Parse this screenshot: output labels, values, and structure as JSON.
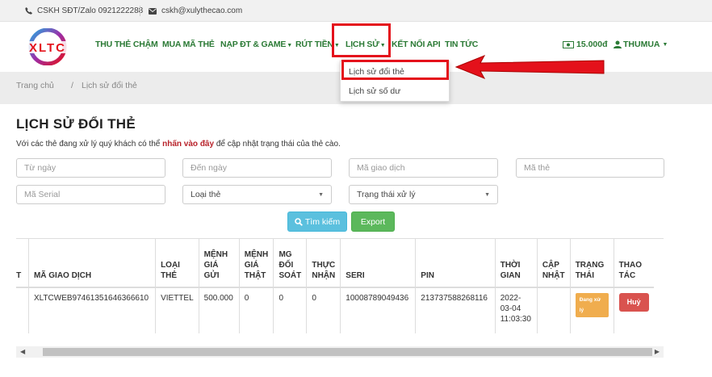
{
  "topbar": {
    "phone_text": "CSKH SĐT/Zalo 0921222288",
    "email_text": "cskh@xulythecao.com"
  },
  "logo": {
    "text": "XLTC"
  },
  "nav": {
    "items": [
      {
        "label": "THU THẺ CHẬM",
        "has_caret": false
      },
      {
        "label": "MUA MÃ THẺ",
        "has_caret": false
      },
      {
        "label": "NẠP ĐT & GAME",
        "has_caret": true
      },
      {
        "label": "RÚT TIỀN",
        "has_caret": true
      },
      {
        "label": "LỊCH SỬ",
        "has_caret": true
      },
      {
        "label": "KẾT NỐI API",
        "has_caret": false
      },
      {
        "label": "TIN TỨC",
        "has_caret": false
      }
    ],
    "balance": "15.000đ",
    "user": "THUMUA"
  },
  "dropdown": {
    "items": [
      "Lịch sử đổi thẻ",
      "Lịch sử số dư"
    ]
  },
  "breadcrumb": {
    "home": "Trang chủ",
    "separator": "/",
    "current": "Lịch sử đổi thẻ"
  },
  "page": {
    "title": "LỊCH SỬ ĐỔI THẺ",
    "notice_prefix": "Với các thẻ đang xử lý quý khách có thể ",
    "notice_link": "nhấn vào đây",
    "notice_suffix": " để cập nhật trạng thái của thẻ cào."
  },
  "filters": {
    "from_date_placeholder": "Từ ngày",
    "to_date_placeholder": "Đến ngày",
    "transaction_code_placeholder": "Mã giao dịch",
    "card_code_placeholder": "Mã thẻ",
    "serial_placeholder": "Mã Serial",
    "card_type_selected": "Loại thẻ",
    "status_selected": "Trạng thái xử lý",
    "search_label": "Tìm kiếm",
    "export_label": "Export"
  },
  "table": {
    "headers": [
      "TT",
      "MÃ GIAO DỊCH",
      "LOẠI THẺ",
      "MỆNH GIÁ GỬI",
      "MỆNH GIÁ THẬT",
      "MG ĐỐI SOÁT",
      "THỰC NHẬN",
      "SERI",
      "PIN",
      "THỜI GIAN",
      "CẬP NHẬT",
      "TRẠNG THÁI",
      "THAO TÁC"
    ],
    "rows": [
      {
        "tt": "",
        "code": "XLTCWEB97461351646366610",
        "type": "VIETTEL",
        "sent": "500.000",
        "real": "0",
        "reconciled": "0",
        "received": "0",
        "serial": "10008789049436",
        "pin": "213737588268116",
        "time": "2022-03-04 11:03:30",
        "updated": "",
        "status": "Đang xử lý",
        "action": "Huỷ"
      }
    ]
  },
  "colors": {
    "nav_green": "#2b7a35",
    "highlight_red": "#e4111b",
    "search_blue": "#5bc0de",
    "export_green": "#5cb85c",
    "status_orange": "#f0ad4e",
    "cancel_red": "#d9534f"
  }
}
